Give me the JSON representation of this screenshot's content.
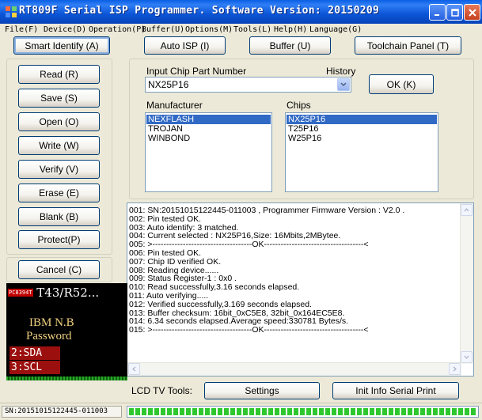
{
  "window": {
    "title": "RT809F Serial ISP Programmer. Software Version: 20150209",
    "icon": "app-icon",
    "controls": [
      "minimize-icon",
      "maximize-icon",
      "close-icon"
    ]
  },
  "menubar": {
    "items": [
      "File(F)",
      "Device(D)",
      "Operation(P)",
      "Buffer(U)",
      "Options(M)",
      "Tools(L)",
      "Help(H)",
      "Language(G)"
    ]
  },
  "toolbar": {
    "smart_identify": "Smart Identify (A)",
    "auto_isp": "Auto ISP (I)",
    "buffer": "Buffer (U)",
    "toolchain_panel": "Toolchain Panel (T)"
  },
  "ops": {
    "read": "Read (R)",
    "save": "Save (S)",
    "open": "Open (O)",
    "write": "Write (W)",
    "verify": "Verify (V)",
    "erase": "Erase (E)",
    "blank": "Blank (B)",
    "protect": "Protect(P)",
    "cancel": "Cancel (C)"
  },
  "chip": {
    "input_label": "Input Chip Part Number",
    "history_label": "History",
    "part_number": "NX25P16",
    "ok_label": "OK (K)",
    "manufacturer_label": "Manufacturer",
    "chips_label": "Chips",
    "manufacturers": [
      "NEXFLASH",
      "TROJAN",
      "WINBOND"
    ],
    "manufacturer_selected": 0,
    "chips": [
      "NX25P16",
      "T25P16",
      "W25P16"
    ],
    "chips_selected": 0
  },
  "log": {
    "lines": [
      "001: SN:20151015122445-011003 , Programmer Firmware Version : V2.0 .",
      "002: Pin tested OK.",
      "003: Auto identify: 3 matched.",
      "004: Current selected : NX25P16,Size: 16Mbits,2MBytee.",
      "005: >------------------------------------OK------------------------------------<",
      "006: Pin tested OK.",
      "007: Chip ID verified OK.",
      "008: Reading device......",
      "009: Status Register-1 : 0x0 .",
      "010: Read successfully,3.16 seconds elapsed.",
      "011: Auto verifying.....",
      "012: Verified successfully,3.169 seconds elapsed.",
      "013: Buffer checksum: 16bit_0xC5E8, 32bit_0x164EC5E8.",
      "014: 6.34 seconds elapsed.Average speed:330781 Bytes/s.",
      "015: >------------------------------------OK------------------------------------<"
    ]
  },
  "lcd_tools": {
    "label": "LCD TV Tools:",
    "settings": "Settings",
    "init_info": "Init Info Serial Print"
  },
  "lcd_preview": {
    "chip_id": "PC8394T",
    "header": "T43/R52...",
    "line1": "IBM N.B",
    "line2": "Password",
    "pin1": "2:SDA",
    "pin2": "3:SCL"
  },
  "status": {
    "serial": "SN:20151015122445-011003",
    "progress": 1.0
  },
  "colors": {
    "titlebar": "#0b55d6",
    "selection": "#316ac5",
    "progress": "#2ec82e",
    "lcd_text": "#f0d080",
    "lcd_pin": "#9c0f0f"
  }
}
